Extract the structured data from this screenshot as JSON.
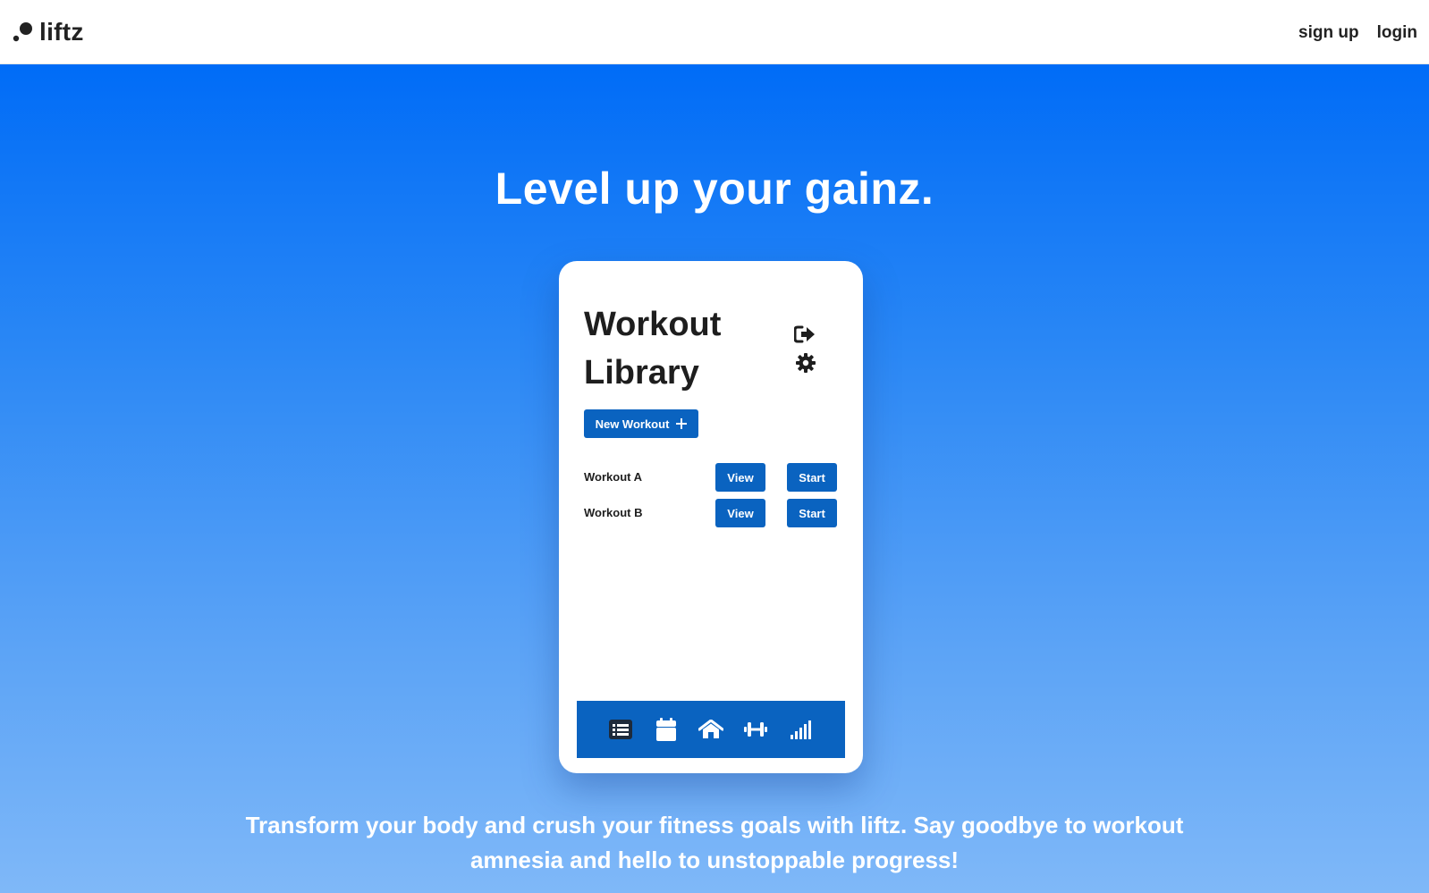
{
  "brand": {
    "name": "liftz",
    "logo_icon": "dots-logo-icon"
  },
  "nav": {
    "signup_label": "sign up",
    "login_label": "login"
  },
  "hero": {
    "headline": "Level up your gainz.",
    "tagline": "Transform your body and crush your fitness goals with liftz. Say goodbye to workout amnesia and hello to unstoppable progress!"
  },
  "app_preview": {
    "title_line1": "Workout",
    "title_line2": "Library",
    "header_icons": [
      "logout-icon",
      "gear-icon"
    ],
    "new_workout_label": "New Workout",
    "new_workout_icon": "plus-icon",
    "workouts": [
      {
        "name": "Workout A",
        "view_label": "View",
        "start_label": "Start"
      },
      {
        "name": "Workout B",
        "view_label": "View",
        "start_label": "Start"
      }
    ],
    "tab_icons": [
      "list-icon",
      "calendar-icon",
      "home-icon",
      "dumbbell-icon",
      "signal-bars-icon"
    ],
    "active_tab": "list-icon"
  },
  "colors": {
    "primary_button": "#0a63c0",
    "hero_top": "#006cf7",
    "hero_bottom": "#7fb8f8",
    "text_dark": "#1e1e1e",
    "white": "#ffffff"
  }
}
